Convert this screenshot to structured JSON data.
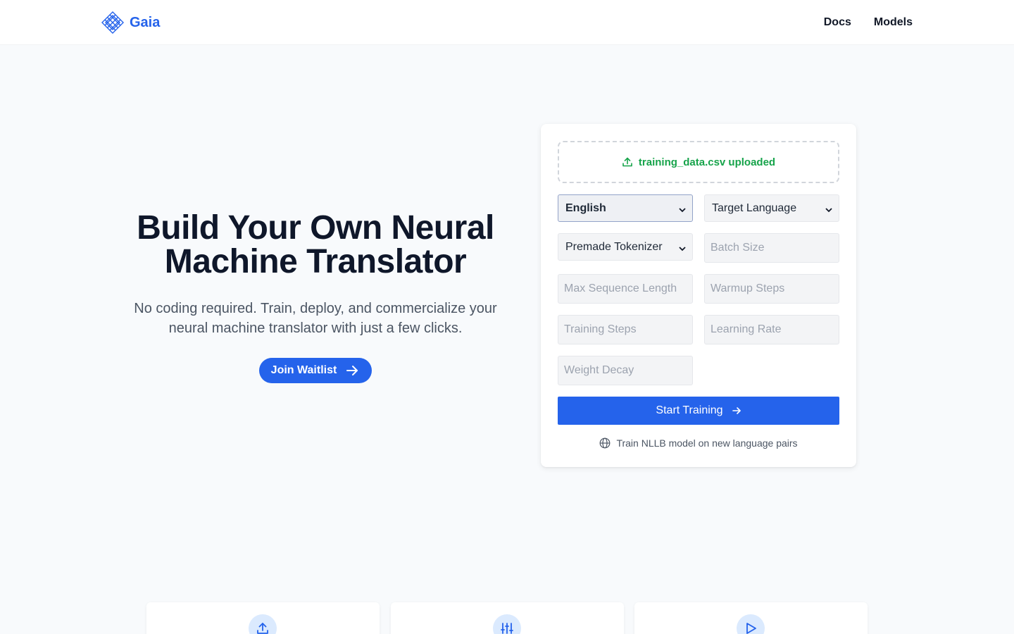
{
  "header": {
    "brand": "Gaia",
    "logo_icon": "diamond-grid-icon",
    "nav": [
      "Docs",
      "Models"
    ]
  },
  "hero": {
    "title_line1": "Build Your Own Neural",
    "title_line2": "Machine Translator",
    "subtitle_line1": "No coding required. Train, deploy, and commercialize your",
    "subtitle_line2": "neural machine translator with just a few clicks.",
    "cta_label": "Join Waitlist",
    "cta_icon": "arrow-right-icon"
  },
  "form": {
    "upload_status": "training_data.csv uploaded",
    "upload_icon": "upload-icon",
    "source_language": "English",
    "target_language": "Target Language",
    "tokenizer": "Premade Tokenizer",
    "placeholders": {
      "batch_size": "Batch Size",
      "max_sequence_length": "Max Sequence Length",
      "warmup_steps": "Warmup Steps",
      "training_steps": "Training Steps",
      "learning_rate": "Learning Rate",
      "weight_decay": "Weight Decay"
    },
    "submit_label": "Start Training",
    "note": "Train NLLB model on new language pairs",
    "note_icon": "globe-icon"
  },
  "features": [
    {
      "icon": "upload-icon"
    },
    {
      "icon": "sliders-icon"
    },
    {
      "icon": "play-icon"
    }
  ],
  "colors": {
    "accent": "#2563eb",
    "success": "#16a34a",
    "background": "#f8fafc"
  }
}
